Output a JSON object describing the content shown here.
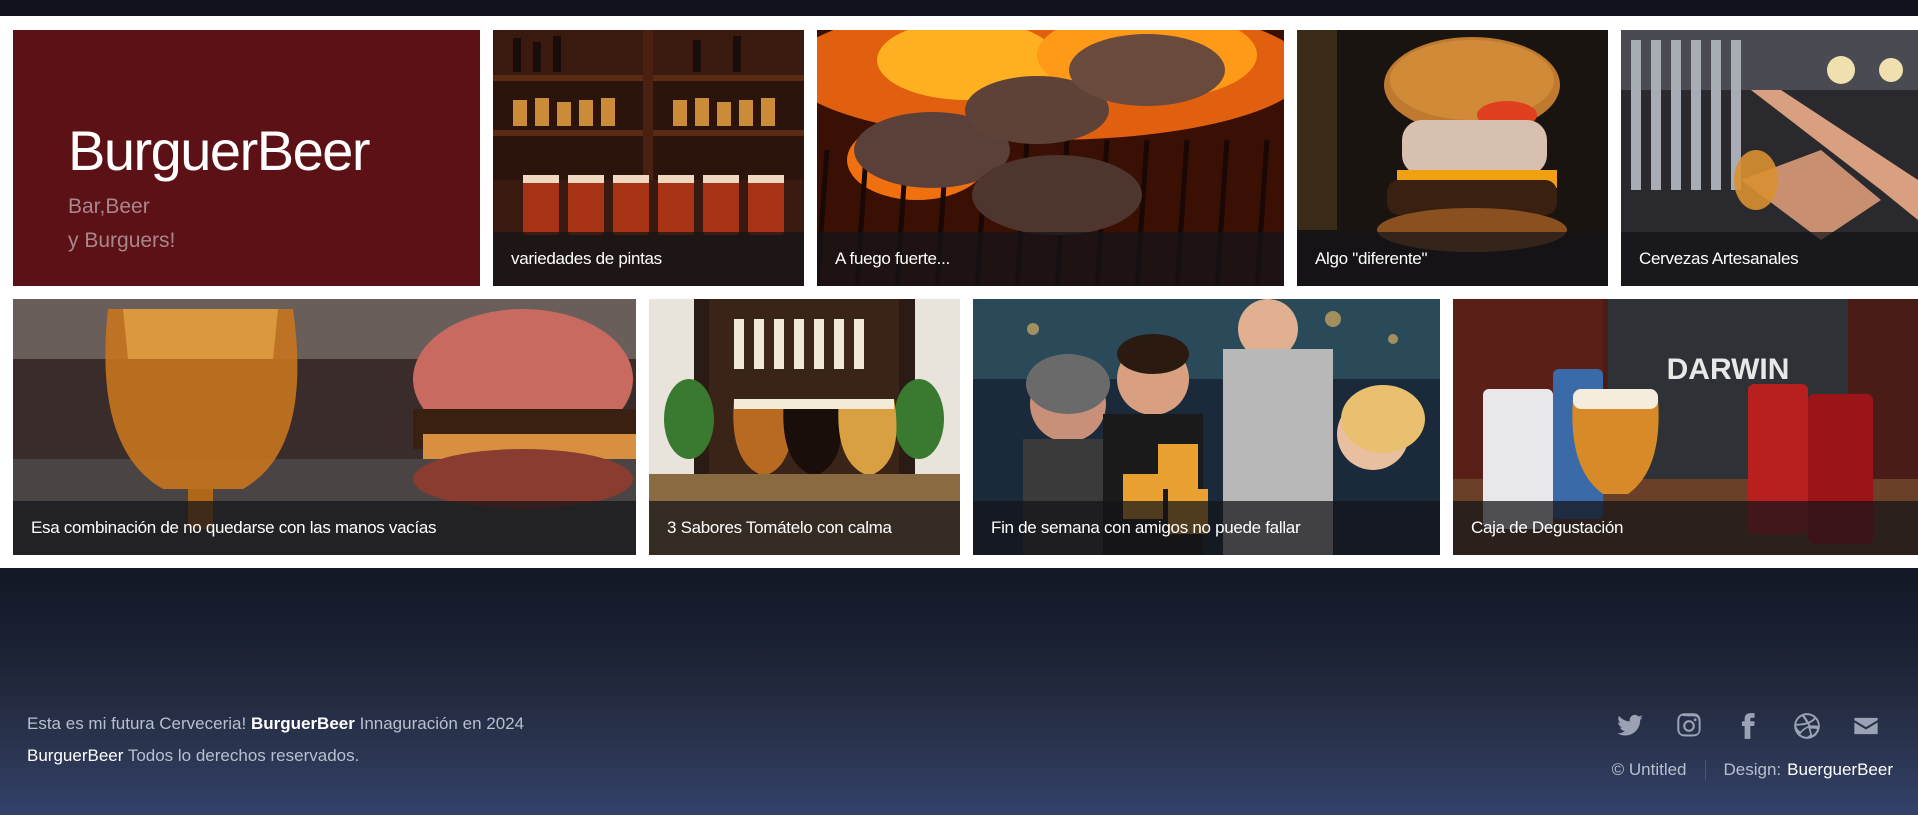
{
  "hero": {
    "title": "BurguerBeer",
    "subtitle_line1": "Bar,Beer",
    "subtitle_line2": "y Burguers!"
  },
  "tiles": [
    {
      "caption": "variedades de pintas",
      "icon": "pints-shelf-image"
    },
    {
      "caption": "A fuego fuerte...",
      "icon": "grill-image"
    },
    {
      "caption": "Algo \"diferente\"",
      "icon": "burger-image"
    },
    {
      "caption": "Cervezas Artesanales",
      "icon": "beer-tap-image"
    },
    {
      "caption": "Esa combinación de no quedarse con las manos vacías",
      "icon": "beer-burger-image"
    },
    {
      "caption": "3 Sabores Tomátelo con calma",
      "icon": "three-beers-image"
    },
    {
      "caption": "Fin de semana con amigos no puede fallar",
      "icon": "friends-toast-image"
    },
    {
      "caption": "Caja de Degustación",
      "icon": "darwin-box-image"
    }
  ],
  "footer": {
    "line1_prefix": "Esta es mi futura Cerveceria!",
    "line1_brand": "BurguerBeer",
    "line1_suffix": "Innaguración en 2024",
    "line2_brand": "BurguerBeer",
    "line2_suffix": "Todos lo derechos reservados.",
    "copyright": "© Untitled",
    "design_label": "Design:",
    "designer": "BuerguerBeer",
    "social": [
      "twitter-icon",
      "instagram-icon",
      "facebook-icon",
      "dribbble-icon",
      "envelope-icon"
    ]
  },
  "colors": {
    "hero_bg": "#5c1116",
    "caption_bg": "rgba(20,20,24,0.72)",
    "footer_text": "#b8bfcf"
  }
}
